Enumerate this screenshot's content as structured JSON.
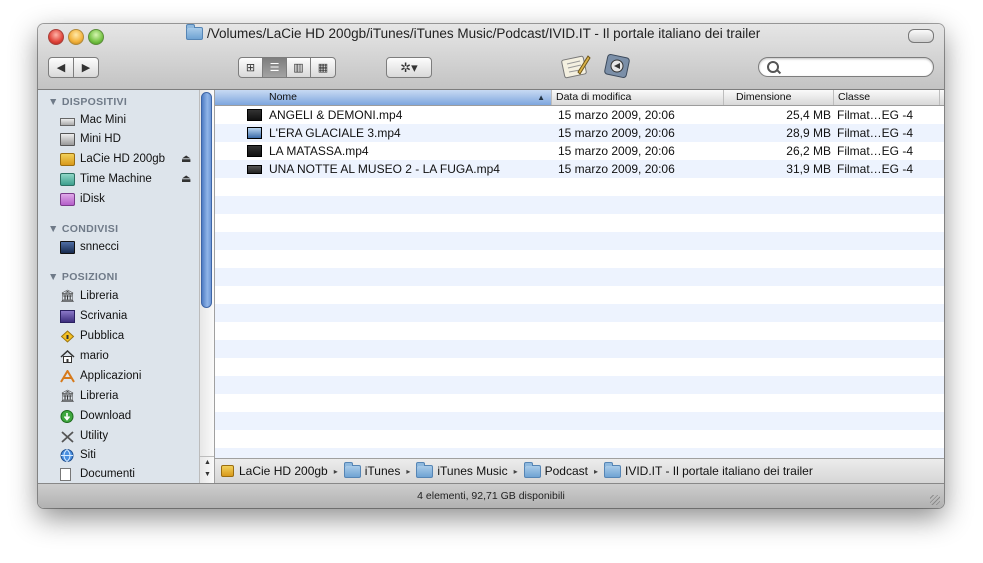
{
  "window": {
    "title": "/Volumes/LaCie HD 200gb/iTunes/iTunes Music/Podcast/IVID.IT - Il portale italiano dei trailer"
  },
  "toolbar": {
    "nav_back_icon": "◀",
    "nav_fwd_icon": "▶",
    "view_icons": [
      "⊞",
      "☰",
      "▥",
      "▦"
    ],
    "action_label": "✲▾",
    "search": {
      "value": "",
      "placeholder": ""
    }
  },
  "sidebar": {
    "sections": [
      {
        "header": "▼ DISPOSITIVI",
        "items": [
          {
            "label": "Mac Mini",
            "icon": "mac-mini-icon"
          },
          {
            "label": "Mini HD",
            "icon": "hard-disk-icon"
          },
          {
            "label": "LaCie HD 200gb",
            "icon": "external-drive-icon",
            "eject": "⏏"
          },
          {
            "label": "Time Machine",
            "icon": "time-machine-icon",
            "eject": "⏏"
          },
          {
            "label": "iDisk",
            "icon": "idisk-icon"
          }
        ]
      },
      {
        "header": "▼ CONDIVISI",
        "items": [
          {
            "label": "snnecci",
            "icon": "network-computer-icon"
          }
        ]
      },
      {
        "header": "▼ POSIZIONI",
        "items": [
          {
            "label": "Libreria",
            "icon": "library-icon"
          },
          {
            "label": "Scrivania",
            "icon": "desktop-icon"
          },
          {
            "label": "Pubblica",
            "icon": "public-folder-icon"
          },
          {
            "label": "mario",
            "icon": "home-icon"
          },
          {
            "label": "Applicazioni",
            "icon": "applications-icon"
          },
          {
            "label": "Libreria",
            "icon": "library-icon"
          },
          {
            "label": "Download",
            "icon": "download-icon"
          },
          {
            "label": "Utility",
            "icon": "utility-icon"
          },
          {
            "label": "Siti",
            "icon": "sites-icon"
          },
          {
            "label": "Documenti",
            "icon": "documents-icon"
          }
        ]
      }
    ],
    "scroll_arrows": "▲▼"
  },
  "columns": {
    "name": "Nome",
    "date": "Data di modifica",
    "size": "Dimensione",
    "kind": "Classe",
    "sort_indicator": "▲"
  },
  "files": [
    {
      "name": "ANGELI & DEMONI.mp4",
      "date": "15 marzo 2009, 20:06",
      "size": "25,4 MB",
      "kind": "Filmat…EG -4"
    },
    {
      "name": "L'ERA GLACIALE 3.mp4",
      "date": "15 marzo 2009, 20:06",
      "size": "28,9 MB",
      "kind": "Filmat…EG -4"
    },
    {
      "name": "LA MATASSA.mp4",
      "date": "15 marzo 2009, 20:06",
      "size": "26,2 MB",
      "kind": "Filmat…EG -4"
    },
    {
      "name": "UNA NOTTE AL MUSEO 2 - LA FUGA.mp4",
      "date": "15 marzo 2009, 20:06",
      "size": "31,9 MB",
      "kind": "Filmat…EG -4"
    }
  ],
  "pathbar": {
    "segments": [
      "LaCie HD 200gb",
      "iTunes",
      "iTunes Music",
      "Podcast",
      "IVID.IT - Il portale italiano dei trailer"
    ],
    "separator": "▸"
  },
  "status": {
    "text": "4 elementi, 92,71 GB disponibili"
  }
}
